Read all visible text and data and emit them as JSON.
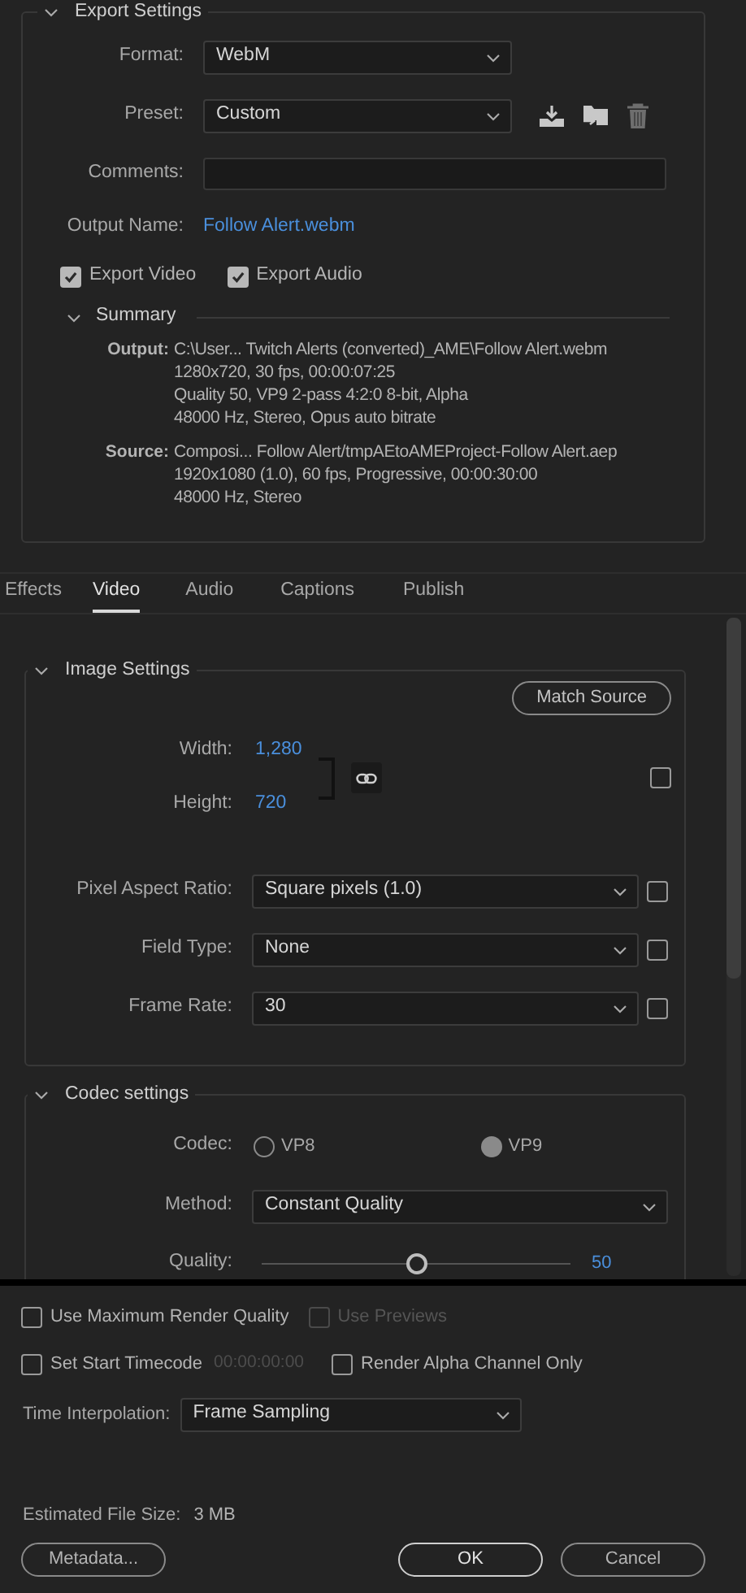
{
  "export_settings": {
    "title": "Export Settings",
    "expanded": true,
    "format": {
      "label": "Format:",
      "value": "WebM"
    },
    "preset": {
      "label": "Preset:",
      "value": "Custom"
    },
    "comments": {
      "label": "Comments:"
    },
    "output_name": {
      "label": "Output Name:",
      "value": "Follow Alert.webm"
    },
    "options": [
      {
        "label": "Export Video",
        "checked": true
      },
      {
        "label": "Export Audio",
        "checked": true
      }
    ],
    "summary": {
      "title": "Summary",
      "expanded": true,
      "groups": [
        {
          "label": "Output:",
          "lines": [
            "C:\\User... Twitch Alerts (converted)_AME\\Follow Alert.webm",
            "1280x720, 30 fps, 00:00:07:25",
            "Quality 50, VP9 2-pass 4:2:0 8-bit, Alpha",
            "48000 Hz, Stereo, Opus auto bitrate"
          ]
        },
        {
          "label": "Source:",
          "lines": [
            "Composi... Follow Alert/tmpAEtoAMEProject-Follow Alert.aep",
            "1920x1080 (1.0), 60 fps, Progressive, 00:00:30:00",
            "48000 Hz, Stereo"
          ]
        }
      ]
    }
  },
  "tabs": [
    {
      "label": "Effects",
      "selected": false
    },
    {
      "label": "Video",
      "selected": true
    },
    {
      "label": "Audio",
      "selected": false
    },
    {
      "label": "Captions",
      "selected": false
    },
    {
      "label": "Publish",
      "selected": false
    }
  ],
  "image_settings": {
    "title": "Image Settings",
    "expanded": true,
    "match_source": "Match Source",
    "width": {
      "label": "Width:",
      "value": "1,280"
    },
    "height": {
      "label": "Height:",
      "value": "720"
    },
    "size_checked": false,
    "fields": [
      {
        "label": "Pixel Aspect Ratio:",
        "value": "Square pixels (1.0)",
        "checked": false
      },
      {
        "label": "Field Type:",
        "value": "None",
        "checked": false
      },
      {
        "label": "Frame Rate:",
        "value": "30",
        "checked": false
      }
    ]
  },
  "codec_settings": {
    "title": "Codec settings",
    "expanded": true,
    "codec": {
      "label": "Codec:",
      "options": [
        {
          "label": "VP8",
          "selected": false
        },
        {
          "label": "VP9",
          "selected": true
        }
      ]
    },
    "method": {
      "label": "Method:",
      "value": "Constant Quality"
    },
    "quality": {
      "label": "Quality:",
      "level": 0.5,
      "reading": "50"
    }
  },
  "render_options": [
    {
      "label": "Use Maximum Render Quality",
      "checked": false,
      "disabled": false
    },
    {
      "label": "Use Previews",
      "checked": false,
      "disabled": true
    },
    {
      "label": "Set Start Timecode",
      "checked": false,
      "disabled": false,
      "value": "00:00:00:00"
    },
    {
      "label": "Render Alpha Channel Only",
      "checked": false,
      "disabled": false
    }
  ],
  "time_interpolation": {
    "label": "Time Interpolation:",
    "value": "Frame Sampling"
  },
  "estimated_file_size": {
    "label": "Estimated File Size:",
    "value": "3 MB"
  },
  "buttons": [
    {
      "label": "Metadata...",
      "kind": "secondary"
    },
    {
      "label": "OK",
      "kind": "primary"
    },
    {
      "label": "Cancel",
      "kind": "secondary"
    }
  ]
}
